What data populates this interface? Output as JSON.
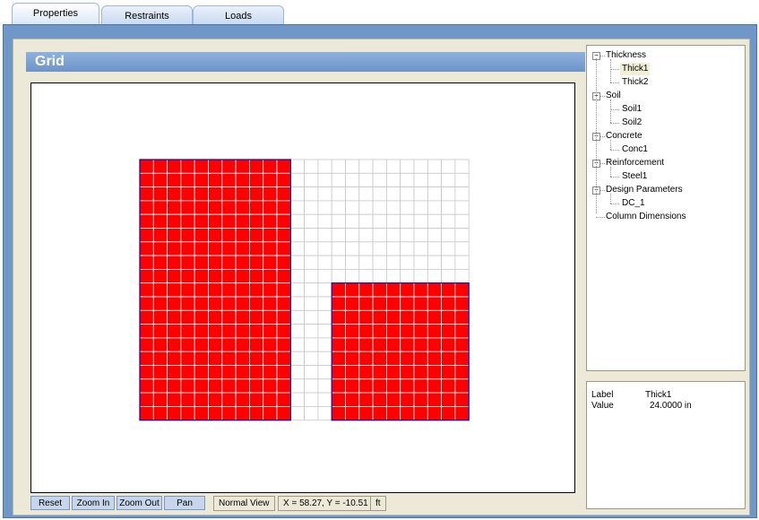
{
  "tabs": [
    {
      "label": "Properties",
      "active": true
    },
    {
      "label": "Restraints",
      "active": false
    },
    {
      "label": "Loads",
      "active": false
    }
  ],
  "grid_panel": {
    "title": "Grid"
  },
  "grid": {
    "cols": 24,
    "rows": 19,
    "filled_color": "#ff0000",
    "outline_color": "#0000c8",
    "line_color": "#c8c8c8",
    "filled_regions": [
      {
        "col_start": 0,
        "col_end": 10,
        "row_start": 0,
        "row_end": 18
      },
      {
        "col_start": 14,
        "col_end": 23,
        "row_start": 9,
        "row_end": 18
      }
    ],
    "empty_regions": [
      {
        "col_start": 11,
        "col_end": 23,
        "row_start": 0,
        "row_end": 8
      },
      {
        "col_start": 11,
        "col_end": 13,
        "row_start": 9,
        "row_end": 18
      }
    ]
  },
  "toolbar": {
    "reset": "Reset",
    "zoom_in": "Zoom In",
    "zoom_out": "Zoom Out",
    "pan": "Pan",
    "view_mode": "Normal View",
    "coords": "X = 58.27, Y = -10.51",
    "units": "ft"
  },
  "tree": [
    {
      "label": "Thickness",
      "children": [
        "Thick1",
        "Thick2"
      ]
    },
    {
      "label": "Soil",
      "children": [
        "Soil1",
        "Soil2"
      ]
    },
    {
      "label": "Concrete",
      "children": [
        "Conc1"
      ]
    },
    {
      "label": "Reinforcement",
      "children": [
        "Steel1"
      ]
    },
    {
      "label": "Design Parameters",
      "children": [
        "DC_1"
      ]
    },
    {
      "label": "Column Dimensions",
      "children": []
    }
  ],
  "tree_selected": "Thick1",
  "properties": {
    "label_key": "Label",
    "label_value": "Thick1",
    "value_key": "Value",
    "value_value": "24.0000 in"
  }
}
